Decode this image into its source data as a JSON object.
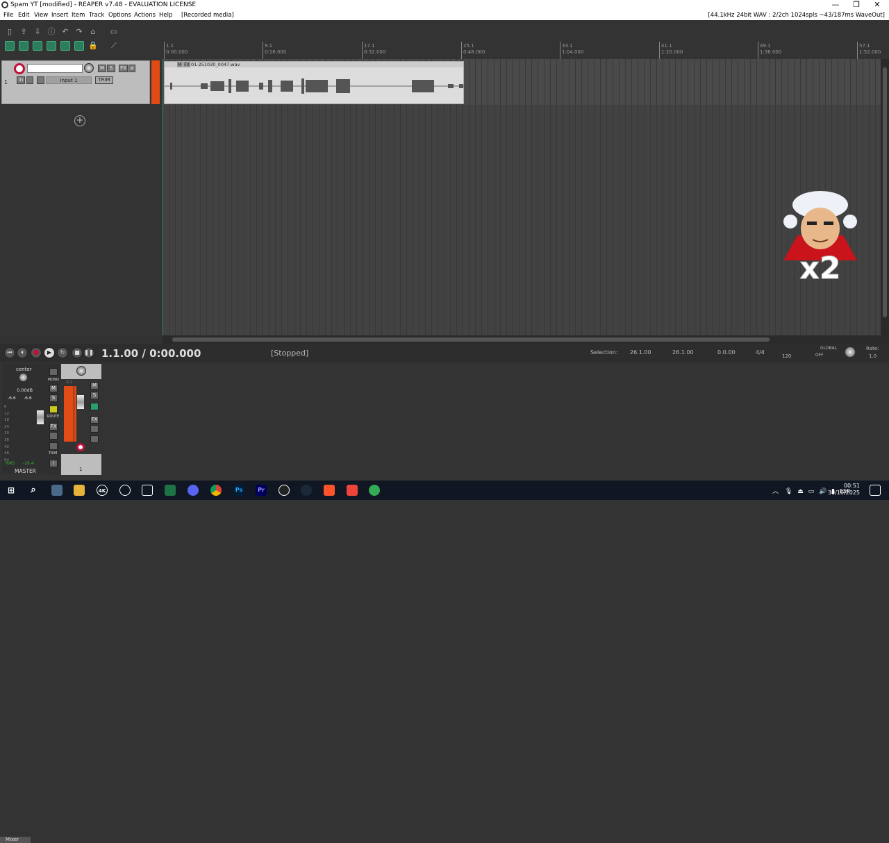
{
  "window": {
    "title": "Spam YT [modified] - REAPER v7.48 - EVALUATION LICENSE",
    "minimize": "—",
    "restore": "❐",
    "close": "✕"
  },
  "menu": {
    "items": [
      "File",
      "Edit",
      "View",
      "Insert",
      "Item",
      "Track",
      "Options",
      "Actions",
      "Help",
      "[Recorded media]"
    ],
    "status": "[44.1kHz 24bit WAV : 2/2ch 1024spls ~43/187ms WaveOut]"
  },
  "ruler": {
    "markers": [
      {
        "bar": "1.1",
        "time": "0:00.000"
      },
      {
        "bar": "9.1",
        "time": "0:16.000"
      },
      {
        "bar": "17.1",
        "time": "0:32.000"
      },
      {
        "bar": "25.1",
        "time": "0:48.000"
      },
      {
        "bar": "33.1",
        "time": "1:04.000"
      },
      {
        "bar": "41.1",
        "time": "1:20.000"
      },
      {
        "bar": "49.1",
        "time": "1:36.000"
      },
      {
        "bar": "57.1",
        "time": "1:52.000"
      }
    ]
  },
  "track": {
    "number": "1",
    "input": "Input 1",
    "trim": "TRIM",
    "mute": "M",
    "solo": "S",
    "fx": "FX",
    "in_label": "in",
    "phase": "ø"
  },
  "item": {
    "name": "01-251030_0047.wav",
    "m": "M",
    "fx": "FX"
  },
  "addtrack": "+",
  "transport": {
    "time": "1.1.00 / 0:00.000",
    "state": "[Stopped]",
    "selection_label": "Selection:",
    "sel_start": "26.1.00",
    "sel_end": "26.1.00",
    "sel_len": "0.0.00",
    "timesig": "4/4",
    "bpm": "120",
    "global": "GLOBAL",
    "global_state": "OFF",
    "rate_label": "Rate:",
    "rate": "1.0",
    "btn_rewind": "⏮",
    "btn_back": "⏴",
    "btn_record": "●",
    "btn_play": "▶",
    "btn_loop": "↻",
    "btn_stop": "■",
    "btn_pause": "❚❚"
  },
  "mixer": {
    "master_pan": "center",
    "master_db": "0.00dB",
    "peak_l": "-6.6",
    "peak_r": "-6.6",
    "rms_label": "RMS",
    "rms_val": "-16.4",
    "master_label": "MASTER",
    "mono": "MONO",
    "route": "ROUTE",
    "trim": "TRIM",
    "track_num": "1",
    "track_db": "-3.1",
    "tab": "Mixer",
    "mute": "M",
    "solo": "S",
    "fx": "FX",
    "info": "i",
    "scale": [
      "6",
      "12",
      "18",
      "24",
      "30",
      "36",
      "42",
      "48",
      "54"
    ]
  },
  "taskbar": {
    "time": "00:51",
    "date": "30/10/2025",
    "lang": "ESP",
    "icons": [
      "start",
      "search",
      "task-view",
      "file-explorer",
      "4k-video",
      "app-circle",
      "keyboard",
      "excel",
      "discord",
      "chrome",
      "photoshop",
      "premiere",
      "obs",
      "steam",
      "brave",
      "anydesk",
      "reaper"
    ],
    "icon_labels": {
      "4k": "4K",
      "ps": "Ps",
      "pr": "Pr"
    }
  },
  "sticker": {
    "text": "x2"
  }
}
